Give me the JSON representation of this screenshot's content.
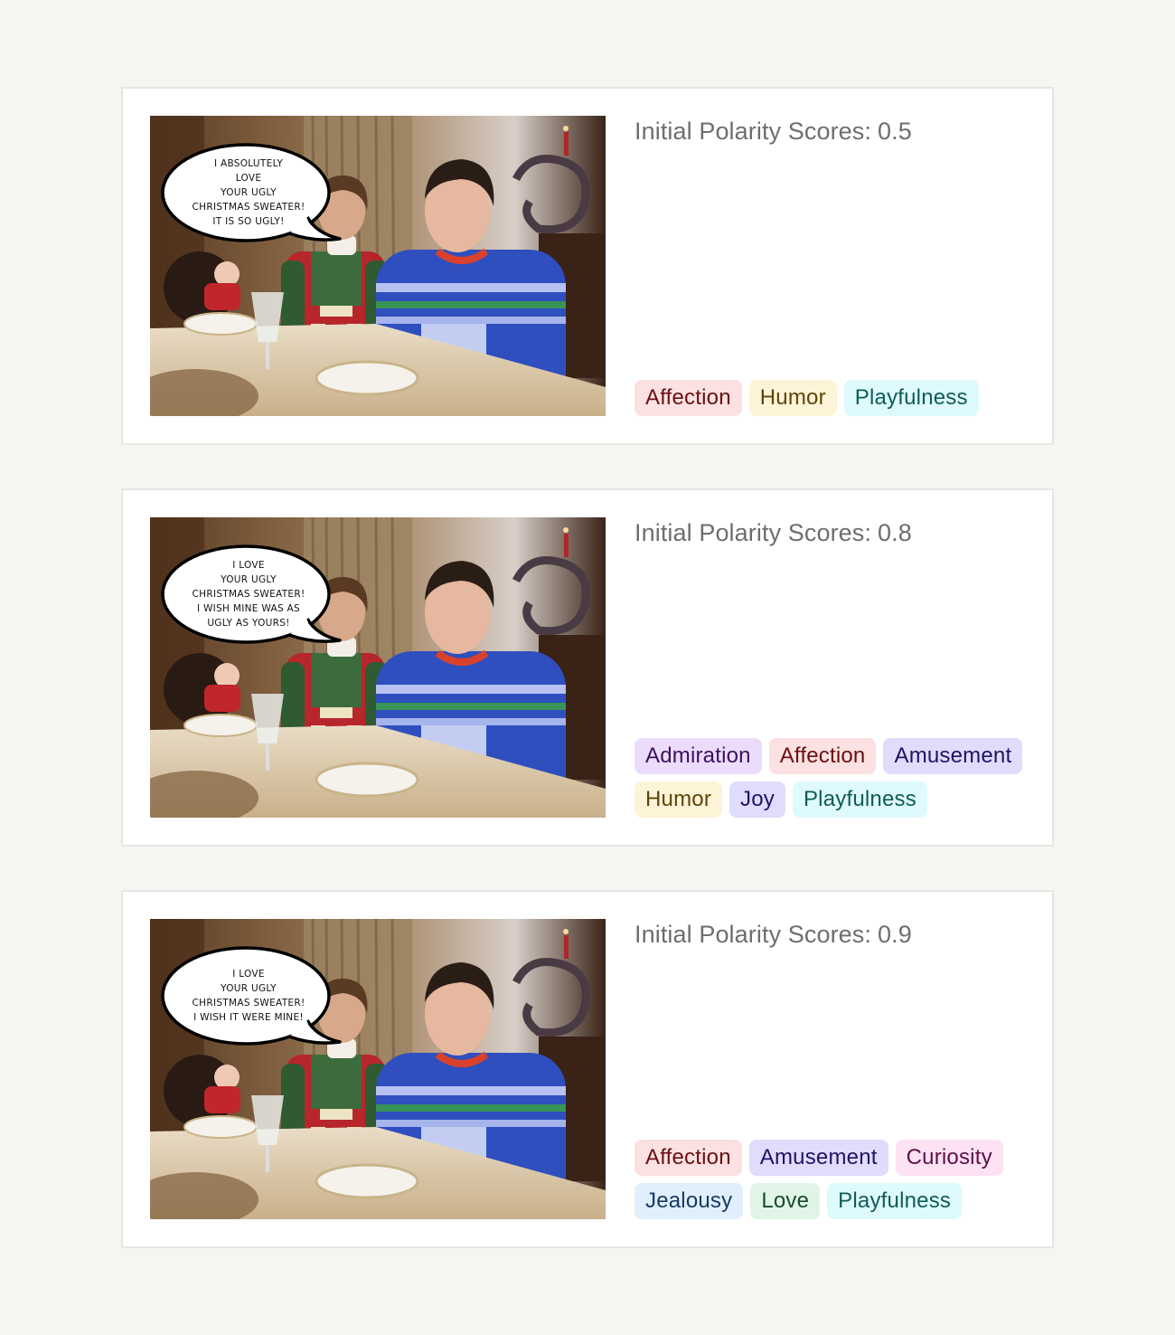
{
  "tag_styles": {
    "Affection": {
      "bg": "#fbe1e1",
      "fg": "#6b0f12"
    },
    "Humor": {
      "bg": "#fdf3d6",
      "fg": "#5c4508"
    },
    "Playfulness": {
      "bg": "#dffafc",
      "fg": "#0e5c58"
    },
    "Admiration": {
      "bg": "#ecdcfb",
      "fg": "#3b1260"
    },
    "Amusement": {
      "bg": "#dfdcfc",
      "fg": "#1f1466"
    },
    "Joy": {
      "bg": "#dfdcfc",
      "fg": "#1f1466"
    },
    "Curiosity": {
      "bg": "#fde2f3",
      "fg": "#5e0f45"
    },
    "Jealousy": {
      "bg": "#e1effc",
      "fg": "#153a64"
    },
    "Love": {
      "bg": "#e0f5e7",
      "fg": "#1b4a2f"
    }
  },
  "score_label": "Initial Polarity Scores:",
  "cards": [
    {
      "score": "0.5",
      "bubble_text": "I absolutely\nlove\nyour ugly\nChristmas sweater!\nIt is so ugly!",
      "tags": [
        "Affection",
        "Humor",
        "Playfulness"
      ]
    },
    {
      "score": "0.8",
      "bubble_text": "I love\nyour ugly\nChristmas sweater!\nI wish mine was as\nugly as yours!",
      "tags": [
        "Admiration",
        "Affection",
        "Amusement",
        "Humor",
        "Joy",
        "Playfulness"
      ]
    },
    {
      "score": "0.9",
      "bubble_text": "I love\nyour ugly\nChristmas sweater!\nI wish it were mine!",
      "tags": [
        "Affection",
        "Amusement",
        "Curiosity",
        "Jealousy",
        "Love",
        "Playfulness"
      ]
    }
  ]
}
